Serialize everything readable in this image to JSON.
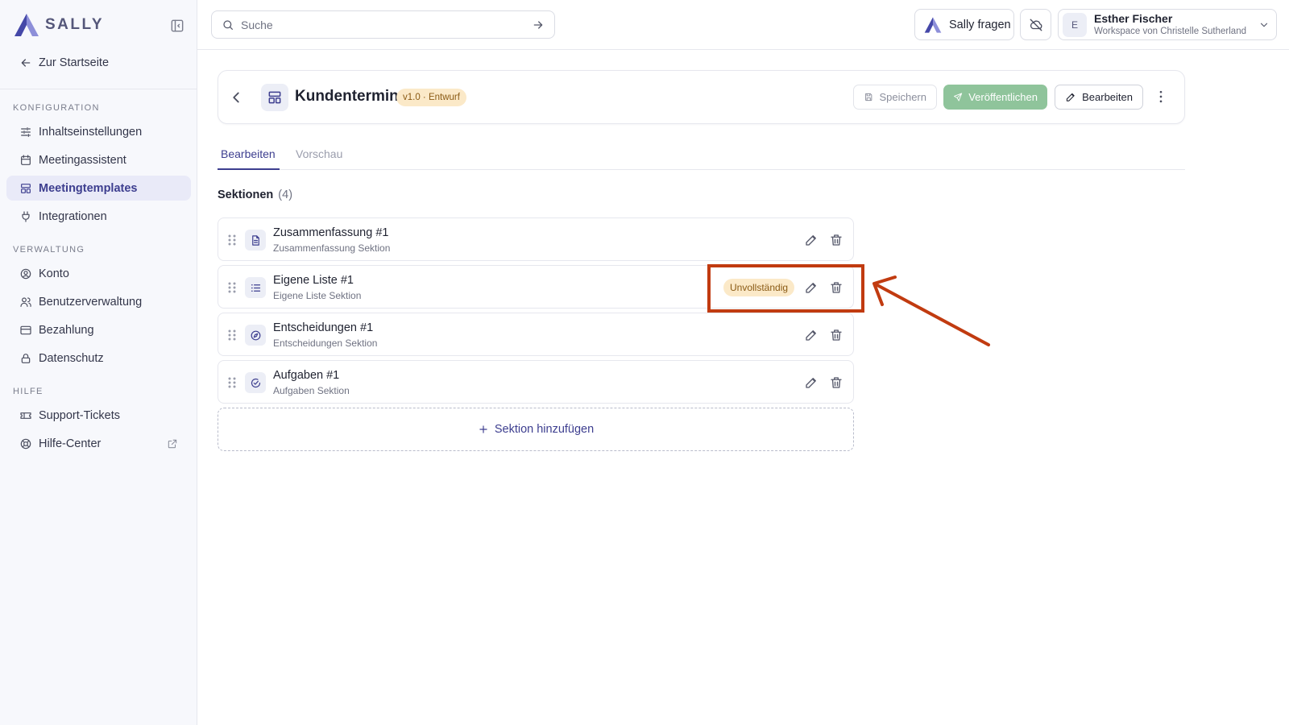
{
  "brand": {
    "name": "SALLY",
    "accent": "#3d3e8f"
  },
  "sidebar": {
    "home_label": "Zur Startseite",
    "groups": [
      {
        "heading": "KONFIGURATION",
        "items": [
          {
            "label": "Inhaltseinstellungen",
            "icon": "sliders-icon"
          },
          {
            "label": "Meetingassistent",
            "icon": "calendar-icon"
          },
          {
            "label": "Meetingtemplates",
            "icon": "layout-template-icon",
            "active": true
          },
          {
            "label": "Integrationen",
            "icon": "plug-icon"
          }
        ]
      },
      {
        "heading": "VERWALTUNG",
        "items": [
          {
            "label": "Konto",
            "icon": "user-circle-icon"
          },
          {
            "label": "Benutzerverwaltung",
            "icon": "users-icon"
          },
          {
            "label": "Bezahlung",
            "icon": "credit-card-icon"
          },
          {
            "label": "Datenschutz",
            "icon": "lock-icon"
          }
        ]
      },
      {
        "heading": "HILFE",
        "items": [
          {
            "label": "Support-Tickets",
            "icon": "ticket-icon"
          },
          {
            "label": "Hilfe-Center",
            "icon": "lifebuoy-icon",
            "external": true
          }
        ]
      }
    ]
  },
  "topbar": {
    "search_placeholder": "Suche",
    "ask_label": "Sally fragen",
    "user": {
      "initial": "E",
      "name": "Esther Fischer",
      "workspace": "Workspace von Christelle Sutherland"
    }
  },
  "template": {
    "title": "Kundentermin",
    "version_badge": "v1.0 · Entwurf",
    "save_label": "Speichern",
    "publish_label": "Veröffentlichen",
    "edit_label": "Bearbeiten"
  },
  "tabs": [
    {
      "label": "Bearbeiten",
      "active": true
    },
    {
      "label": "Vorschau",
      "active": false
    }
  ],
  "sections": {
    "heading": "Sektionen",
    "count": "(4)",
    "items": [
      {
        "title": "Zusammenfassung #1",
        "subtitle": "Zusammenfassung Sektion",
        "icon": "document-icon"
      },
      {
        "title": "Eigene Liste #1",
        "subtitle": "Eigene Liste Sektion",
        "icon": "list-icon",
        "badge": "Unvollständig"
      },
      {
        "title": "Entscheidungen #1",
        "subtitle": "Entscheidungen Sektion",
        "icon": "compass-icon"
      },
      {
        "title": "Aufgaben #1",
        "subtitle": "Aufgaben Sektion",
        "icon": "check-circle-icon"
      }
    ],
    "add_label": "Sektion hinzufügen"
  },
  "annotation": {
    "color": "#c13b10"
  }
}
